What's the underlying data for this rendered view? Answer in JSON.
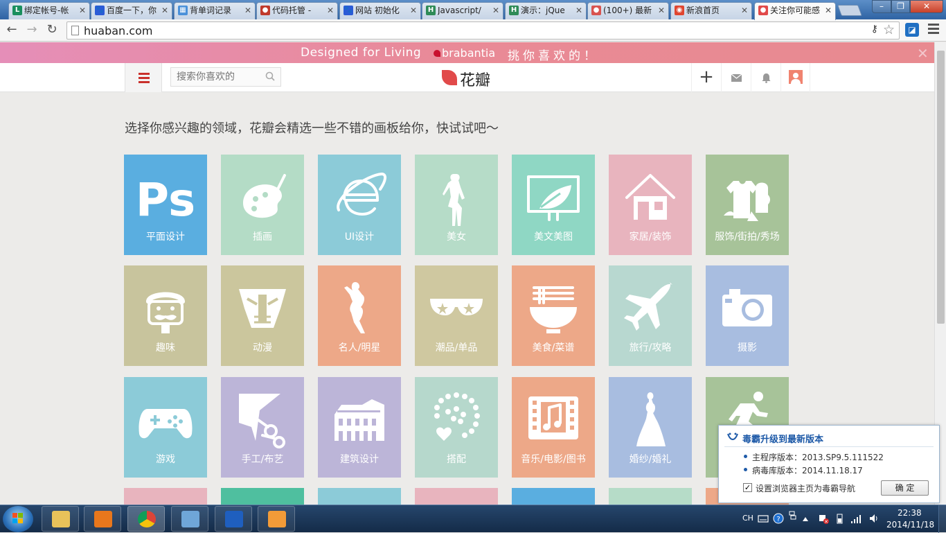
{
  "browser": {
    "tabs": [
      {
        "label": "绑定帐号-帐",
        "fav_color": "#1a8f5e",
        "fav_text": "L"
      },
      {
        "label": "百度一下，你",
        "fav_color": "#2b5bd7",
        "fav_text": "🐾"
      },
      {
        "label": "背单词记录",
        "fav_color": "#4a90d9",
        "fav_text": "▦"
      },
      {
        "label": "代码托管 - ",
        "fav_color": "#c0392b",
        "fav_text": "●"
      },
      {
        "label": "网站 初始化",
        "fav_color": "#2b5bd7",
        "fav_text": "🐾"
      },
      {
        "label": "Javascript/",
        "fav_color": "#2e8b57",
        "fav_text": "H"
      },
      {
        "label": "演示：jQue",
        "fav_color": "#2e8b57",
        "fav_text": "H"
      },
      {
        "label": "(100+) 最新",
        "fav_color": "#d9534f",
        "fav_text": "●"
      },
      {
        "label": "新浪首页",
        "fav_color": "#e0452f",
        "fav_text": "◉"
      },
      {
        "label": "关注你可能感",
        "fav_color": "#e14a4a",
        "fav_text": "●"
      }
    ],
    "tab_close": "✕",
    "url": "huaban.com",
    "back": "←",
    "forward": "→",
    "reload": "↻"
  },
  "banner": {
    "left_text": "Designed for Living",
    "brand": "brabantia",
    "right_text": "挑你喜欢的！",
    "close": "✕"
  },
  "header": {
    "search_placeholder": "搜索你喜欢的",
    "logo_text": "花瓣",
    "add": "+"
  },
  "intro": "选择你感兴趣的领域，花瓣会精选一些不错的画板给你，快试试吧～",
  "categories": [
    {
      "label": "平面设计",
      "color": "#5aaee0",
      "icon": "ps-icon"
    },
    {
      "label": "插画",
      "color": "#b4dcc6",
      "icon": "palette-icon"
    },
    {
      "label": "UI设计",
      "color": "#8ccbd8",
      "icon": "ie-icon"
    },
    {
      "label": "美女",
      "color": "#b6dcc8",
      "icon": "woman-icon"
    },
    {
      "label": "美文美图",
      "color": "#8fd7c4",
      "icon": "leaf-frame-icon"
    },
    {
      "label": "家居/装饰",
      "color": "#e8b4be",
      "icon": "house-icon"
    },
    {
      "label": "服饰/街拍/秀场",
      "color": "#a7c399",
      "icon": "clothes-icon"
    },
    {
      "label": "趣味",
      "color": "#c8c49d",
      "icon": "mustache-icon"
    },
    {
      "label": "动漫",
      "color": "#cbc69d",
      "icon": "robot-icon"
    },
    {
      "label": "名人/明星",
      "color": "#eda888",
      "icon": "dancer-icon"
    },
    {
      "label": "潮品/单品",
      "color": "#cfc8a0",
      "icon": "sunglasses-icon"
    },
    {
      "label": "美食/菜谱",
      "color": "#eda888",
      "icon": "bowl-icon"
    },
    {
      "label": "旅行/攻略",
      "color": "#b8d8d0",
      "icon": "plane-icon"
    },
    {
      "label": "摄影",
      "color": "#a8bde0",
      "icon": "camera-icon"
    },
    {
      "label": "游戏",
      "color": "#8ccbd8",
      "icon": "gamepad-icon"
    },
    {
      "label": "手工/布艺",
      "color": "#bcb5d8",
      "icon": "scissors-icon"
    },
    {
      "label": "建筑设计",
      "color": "#bcb5d8",
      "icon": "colosseum-icon"
    },
    {
      "label": "搭配",
      "color": "#b6d8cc",
      "icon": "necklace-icon"
    },
    {
      "label": "音乐/电影/图书",
      "color": "#eda888",
      "icon": "music-film-icon"
    },
    {
      "label": "婚纱/婚礼",
      "color": "#a8bde0",
      "icon": "bride-icon"
    },
    {
      "label": "",
      "color": "#a7c399",
      "icon": "runner-icon"
    }
  ],
  "partial_row_colors": [
    "#e8b4be",
    "#4fbf9f",
    "#8ccbd8",
    "#e8b4be",
    "#5aaee0",
    "#b6dcc8",
    "#eda888"
  ],
  "popup": {
    "title": "毒霸升级到最新版本",
    "line1": "主程序版本：2013.SP9.5.111522",
    "line2": "病毒库版本：2014.11.18.17",
    "checkbox_label": "设置浏览器主页为毒霸导航",
    "checked": "✓",
    "ok": "确 定"
  },
  "taskbar": {
    "apps": [
      {
        "name": "explorer",
        "color": "#e8c25a"
      },
      {
        "name": "media-player",
        "color": "#e8771c"
      },
      {
        "name": "chrome",
        "color": "#db4437"
      },
      {
        "name": "app-8",
        "color": "#6fa6d8"
      },
      {
        "name": "wps-writer",
        "color": "#1f5fbf"
      },
      {
        "name": "house-app",
        "color": "#f29b38"
      }
    ],
    "lang": "CH",
    "time": "22:38",
    "date": "2014/11/18"
  }
}
